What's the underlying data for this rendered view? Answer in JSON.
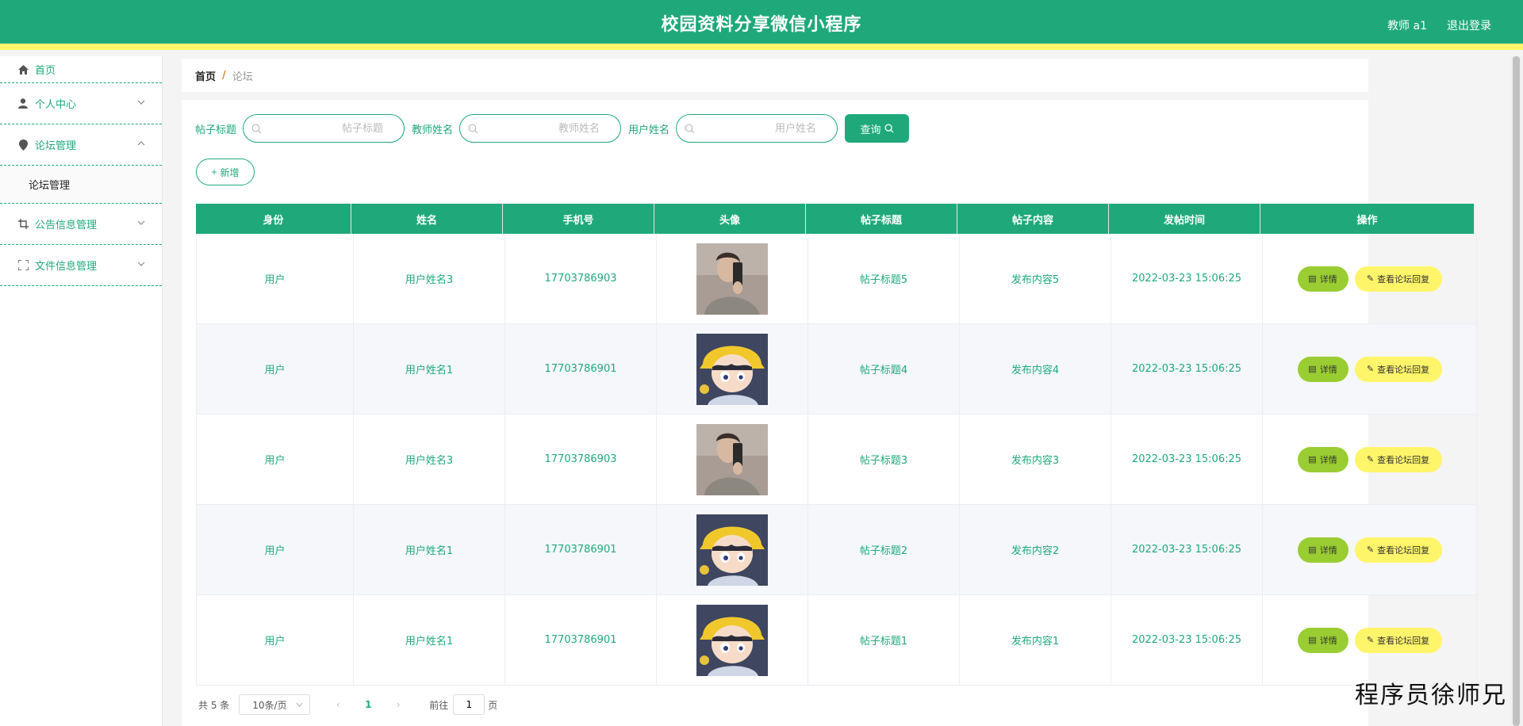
{
  "header": {
    "title": "校园资料分享微信小程序",
    "user": "教师 a1",
    "logout": "退出登录"
  },
  "colors": {
    "primary": "#1fa97b",
    "accent_yellow": "#fff56a",
    "detail_green": "#9acd32"
  },
  "sidebar": {
    "items": [
      {
        "label": "首页",
        "icon": "home-icon"
      },
      {
        "label": "个人中心",
        "icon": "user-icon"
      },
      {
        "label": "论坛管理",
        "icon": "pin-icon"
      },
      {
        "label": "论坛管理",
        "icon": ""
      },
      {
        "label": "公告信息管理",
        "icon": "crop-icon"
      },
      {
        "label": "文件信息管理",
        "icon": "fullscreen-icon"
      }
    ]
  },
  "breadcrumb": {
    "home": "首页",
    "sep": "/",
    "current": "论坛"
  },
  "search": {
    "title_label": "帖子标题",
    "title_placeholder": "帖子标题",
    "teacher_label": "教师姓名",
    "teacher_placeholder": "教师姓名",
    "user_label": "用户姓名",
    "user_placeholder": "用户姓名",
    "query_button": "查询"
  },
  "add_button": "新增",
  "table": {
    "columns": [
      "身份",
      "姓名",
      "手机号",
      "头像",
      "帖子标题",
      "帖子内容",
      "发帖时间",
      "操作"
    ],
    "rows": [
      {
        "role": "用户",
        "name": "用户姓名3",
        "phone": "17703786903",
        "avatar": "male-photo",
        "title": "帖子标题5",
        "content": "发布内容5",
        "time": "2022-03-23 15:06:25"
      },
      {
        "role": "用户",
        "name": "用户姓名1",
        "phone": "17703786901",
        "avatar": "cartoon-boy",
        "title": "帖子标题4",
        "content": "发布内容4",
        "time": "2022-03-23 15:06:25"
      },
      {
        "role": "用户",
        "name": "用户姓名3",
        "phone": "17703786903",
        "avatar": "male-photo",
        "title": "帖子标题3",
        "content": "发布内容3",
        "time": "2022-03-23 15:06:25"
      },
      {
        "role": "用户",
        "name": "用户姓名1",
        "phone": "17703786901",
        "avatar": "cartoon-boy",
        "title": "帖子标题2",
        "content": "发布内容2",
        "time": "2022-03-23 15:06:25"
      },
      {
        "role": "用户",
        "name": "用户姓名1",
        "phone": "17703786901",
        "avatar": "cartoon-boy",
        "title": "帖子标题1",
        "content": "发布内容1",
        "time": "2022-03-23 15:06:25"
      }
    ],
    "detail_button": "详情",
    "reply_button": "查看论坛回复"
  },
  "pagination": {
    "total": "共 5 条",
    "page_size": "10条/页",
    "current_page": "1",
    "goto_label": "前往",
    "goto_value": "1",
    "page_suffix": "页"
  },
  "watermark": "程序员徐师兄"
}
